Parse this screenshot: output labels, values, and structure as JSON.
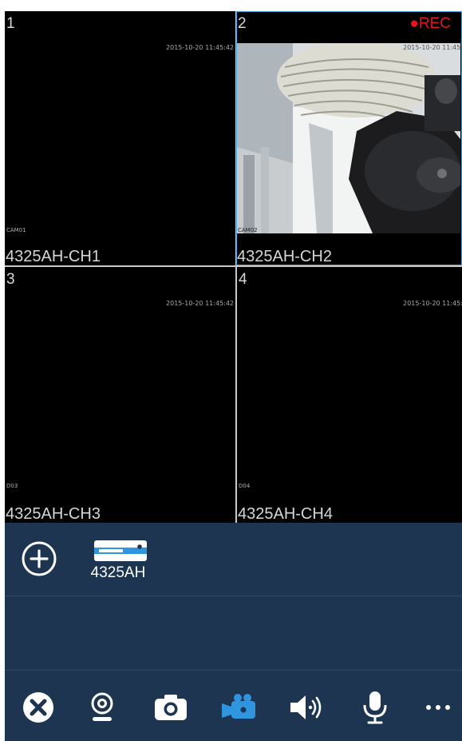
{
  "cameras": [
    {
      "number": "1",
      "timestamp": "2015-10-20 11:45:42",
      "cam_label": "CAM01",
      "name": "4325AH-CH1",
      "recording": false
    },
    {
      "number": "2",
      "timestamp": "2015-10-20 11:45:4",
      "cam_label": "CAM02",
      "name": "4325AH-CH2",
      "recording": true,
      "rec_label": "●REC"
    },
    {
      "number": "3",
      "timestamp": "2015-10-20 11:45:42",
      "cam_label": "D03",
      "name": "4325AH-CH3",
      "recording": false
    },
    {
      "number": "4",
      "timestamp": "2015-10-20 11:45:4",
      "cam_label": "D04",
      "name": "4325AH-CH4",
      "recording": false
    }
  ],
  "devices": [
    {
      "label": "4325AH",
      "icon": "dvr-icon"
    }
  ],
  "toolbar": [
    {
      "icon": "close-circle-icon",
      "active": false
    },
    {
      "icon": "webcam-icon",
      "active": false
    },
    {
      "icon": "camera-snapshot-icon",
      "active": false
    },
    {
      "icon": "video-record-icon",
      "active": true
    },
    {
      "icon": "speaker-icon",
      "active": false
    },
    {
      "icon": "microphone-icon",
      "active": false
    },
    {
      "icon": "more-icon",
      "active": false
    }
  ],
  "colors": {
    "panel_bg": "#1d3550",
    "accent": "#2f95de",
    "rec": "#e8141a",
    "selected_border": "#3fa0d8"
  }
}
